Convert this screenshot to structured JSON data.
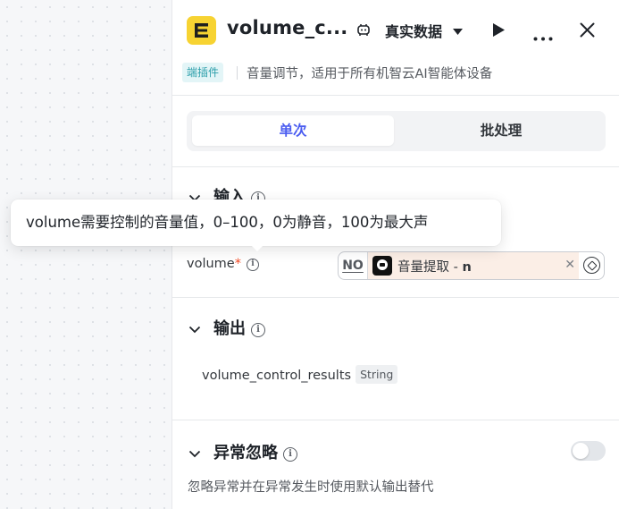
{
  "header": {
    "title": "volume_c...",
    "data_select": "真实数据",
    "plugin_tag": "端插件",
    "description": "音量调节，适用于所有机智云AI智能体设备",
    "colors": {
      "logo_bg": "#f7d332",
      "accent": "#4a5cf0"
    },
    "icons": [
      "plugin-logo-icon",
      "debug-icon",
      "caret-down-icon",
      "run-icon",
      "more-icon",
      "close-icon"
    ]
  },
  "mode_tabs": {
    "single": "单次",
    "batch": "批处理",
    "selected": "单次"
  },
  "input": {
    "title": "输入",
    "param_name": "volume",
    "required_mark": "*",
    "ref_prefix": "NO",
    "ref_node": "音量提取 - ",
    "ref_var": "n",
    "tooltip": "volume需要控制的音量值，0–100，0为静音，100为最大声"
  },
  "output": {
    "title": "输出",
    "field_name": "volume_control_results",
    "field_type": "String"
  },
  "exception": {
    "title": "异常忽略",
    "description": "忽略异常并在异常发生时使用默认输出替代",
    "enabled": false
  }
}
